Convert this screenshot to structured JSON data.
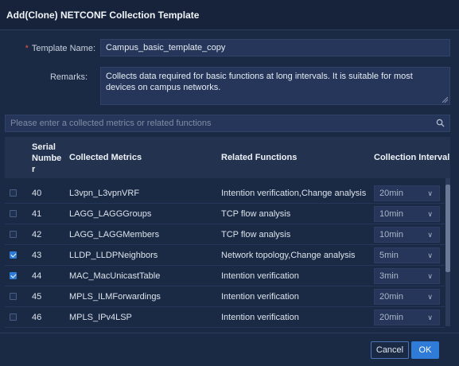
{
  "dialog": {
    "title": "Add(Clone) NETCONF Collection Template"
  },
  "form": {
    "template_name_label": "Template Name:",
    "template_name_value": "Campus_basic_template_copy",
    "remarks_label": "Remarks:",
    "remarks_value": "Collects data required for basic functions at long intervals. It is suitable for most devices on campus networks."
  },
  "search": {
    "placeholder": "Please enter a collected metrics or related functions"
  },
  "table": {
    "headers": {
      "serial_line1": "Serial",
      "serial_line2": "Numbe",
      "serial_line3": "r",
      "metrics": "Collected Metrics",
      "functions": "Related Functions",
      "interval": "Collection Interval"
    },
    "rows": [
      {
        "checked": false,
        "serial": "40",
        "metric": "L3vpn_L3vpnVRF",
        "function": "Intention verification,Change analysis",
        "interval": "20min"
      },
      {
        "checked": false,
        "serial": "41",
        "metric": "LAGG_LAGGGroups",
        "function": "TCP flow analysis",
        "interval": "10min"
      },
      {
        "checked": false,
        "serial": "42",
        "metric": "LAGG_LAGGMembers",
        "function": "TCP flow analysis",
        "interval": "10min"
      },
      {
        "checked": true,
        "serial": "43",
        "metric": "LLDP_LLDPNeighbors",
        "function": "Network topology,Change analysis",
        "interval": "5min"
      },
      {
        "checked": true,
        "serial": "44",
        "metric": "MAC_MacUnicastTable",
        "function": "Intention verification",
        "interval": "3min"
      },
      {
        "checked": false,
        "serial": "45",
        "metric": "MPLS_ILMForwardings",
        "function": "Intention verification",
        "interval": "20min"
      },
      {
        "checked": false,
        "serial": "46",
        "metric": "MPLS_IPv4LSP",
        "function": "Intention verification",
        "interval": "20min"
      }
    ]
  },
  "footer": {
    "cancel_label": "Cancel",
    "ok_label": "OK"
  },
  "colors": {
    "background": "#1b2a44",
    "accent": "#2f7bd8",
    "required": "#e0524f"
  }
}
